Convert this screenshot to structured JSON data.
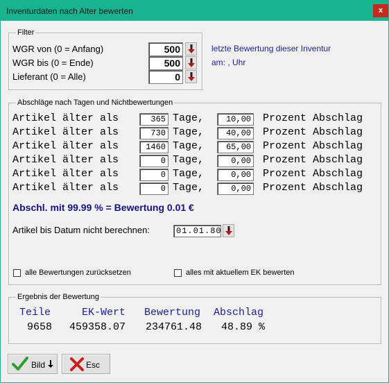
{
  "window": {
    "title": "Inventurdaten nach Alter bewerten",
    "close_glyph": "x",
    "titlebar_color": "#18b38f"
  },
  "filter": {
    "legend": "Filter",
    "rows": [
      {
        "label": "WGR von (0 = Anfang)",
        "value": "500"
      },
      {
        "label": "WGR bis (0 = Ende)",
        "value": "500"
      },
      {
        "label": "Lieferant (0 = Alle)",
        "value": "0"
      }
    ],
    "info_line1": "letzte Bewertung dieser Inventur",
    "info_line2": "am: ,  Uhr"
  },
  "abschlaege": {
    "legend": "Abschläge nach Tagen und Nichtbewertungen",
    "prefix": "Artikel älter als",
    "mid": "Tage,",
    "suffix": "Prozent Abschlag",
    "rows": [
      {
        "days": "365",
        "percent": "10,00"
      },
      {
        "days": "730",
        "percent": "40,00"
      },
      {
        "days": "1460",
        "percent": "65,00"
      },
      {
        "days": "0",
        "percent": "0,00"
      },
      {
        "days": "0",
        "percent": "0,00"
      },
      {
        "days": "0",
        "percent": "0,00"
      }
    ],
    "summary": "Abschl. mit 99.99 % = Bewertung 0.01  €",
    "date_label": "Artikel bis Datum nicht berechnen:",
    "date_value": "01.01.80",
    "reset_all_label": "alle Bewertungen zurücksetzen",
    "current_ek_label": "alles mit aktuellem EK bewerten"
  },
  "ergebnis": {
    "legend": "Ergebnis der Bewertung",
    "headers": [
      "Teile",
      "EK-Wert",
      "Bewertung",
      "Abschlag"
    ],
    "values": [
      "9658",
      "459358.07",
      "234761.48",
      "48.89 %"
    ]
  },
  "buttons": {
    "bild_label": "Bild",
    "esc_label": "Esc"
  }
}
